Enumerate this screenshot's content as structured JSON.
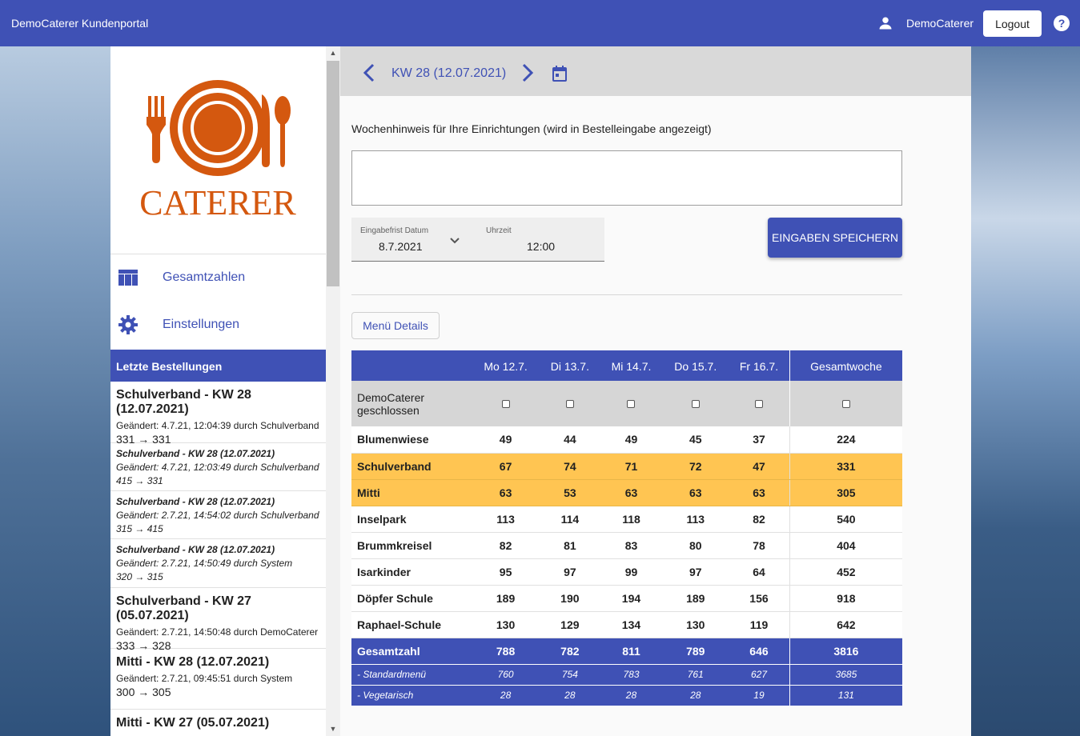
{
  "header": {
    "app_title": "DemoCaterer Kundenportal",
    "user_name": "DemoCaterer",
    "logout_label": "Logout",
    "help_glyph": "?"
  },
  "sidebar": {
    "logo_text": "CATERER",
    "nav": [
      {
        "label": "Gesamtzahlen",
        "icon": "table-icon"
      },
      {
        "label": "Einstellungen",
        "icon": "gear-icon"
      }
    ],
    "orders_title": "Letzte Bestellungen",
    "orders": [
      {
        "title": "Schulverband - KW 28 (12.07.2021)",
        "changed": "Geändert: 4.7.21, 12:04:39 durch Schulverband",
        "value": "331 → 331"
      },
      {
        "title": "Schulverband - KW 28 (12.07.2021)",
        "changed": "Geändert: 4.7.21, 12:03:49 durch Schulverband",
        "value": "415 → 331"
      },
      {
        "title": "Schulverband - KW 28 (12.07.2021)",
        "changed": "Geändert: 2.7.21, 14:54:02 durch Schulverband",
        "value": "315 → 415"
      },
      {
        "title": "Schulverband - KW 28 (12.07.2021)",
        "changed": "Geändert: 2.7.21, 14:50:49 durch System",
        "value": "320 → 315"
      },
      {
        "title": "Schulverband - KW 27 (05.07.2021)",
        "changed": "Geändert: 2.7.21, 14:50:48 durch DemoCaterer",
        "value": "333 → 328"
      },
      {
        "title": "Mitti - KW 28 (12.07.2021)",
        "changed": "Geändert: 2.7.21, 09:45:51 durch System",
        "value": "300 → 305"
      },
      {
        "title": "Mitti - KW 27 (05.07.2021)",
        "changed": "",
        "value": ""
      }
    ]
  },
  "main": {
    "week_label": "KW 28 (12.07.2021)",
    "hint_label": "Wochenhinweis für Ihre Einrichtungen (wird in Bestelleingabe angezeigt)",
    "hint_value": "",
    "deadline_date_label": "Eingabefrist Datum",
    "deadline_date_value": "8.7.2021",
    "deadline_time_label": "Uhrzeit",
    "deadline_time_value": "12:00",
    "save_label": "EINGABEN SPEICHERN",
    "menu_details_label": "Menü Details"
  },
  "table": {
    "columns": [
      "Mo 12.7.",
      "Di 13.7.",
      "Mi 14.7.",
      "Do 15.7.",
      "Fr 16.7.",
      "Gesamtwoche"
    ],
    "closed_label": "DemoCaterer geschlossen",
    "rows": [
      {
        "name": "Blumenwiese",
        "values": [
          "49",
          "44",
          "49",
          "45",
          "37",
          "224"
        ],
        "highlight": false
      },
      {
        "name": "Schulverband",
        "values": [
          "67",
          "74",
          "71",
          "72",
          "47",
          "331"
        ],
        "highlight": true
      },
      {
        "name": "Mitti",
        "values": [
          "63",
          "53",
          "63",
          "63",
          "63",
          "305"
        ],
        "highlight": true
      },
      {
        "name": "Inselpark",
        "values": [
          "113",
          "114",
          "118",
          "113",
          "82",
          "540"
        ],
        "highlight": false
      },
      {
        "name": "Brummkreisel",
        "values": [
          "82",
          "81",
          "83",
          "80",
          "78",
          "404"
        ],
        "highlight": false
      },
      {
        "name": "Isarkinder",
        "values": [
          "95",
          "97",
          "99",
          "97",
          "64",
          "452"
        ],
        "highlight": false
      },
      {
        "name": "Döpfer Schule",
        "values": [
          "189",
          "190",
          "194",
          "189",
          "156",
          "918"
        ],
        "highlight": false
      },
      {
        "name": "Raphael-Schule",
        "values": [
          "130",
          "129",
          "134",
          "130",
          "119",
          "642"
        ],
        "highlight": false
      }
    ],
    "total": {
      "name": "Gesamtzahl",
      "values": [
        "788",
        "782",
        "811",
        "789",
        "646",
        "3816"
      ]
    },
    "subtotals": [
      {
        "name": "- Standardmenü",
        "values": [
          "760",
          "754",
          "783",
          "761",
          "627",
          "3685"
        ]
      },
      {
        "name": "- Vegetarisch",
        "values": [
          "28",
          "28",
          "28",
          "28",
          "19",
          "131"
        ]
      }
    ]
  },
  "colors": {
    "primary": "#3f51b5",
    "highlight": "#ffc552",
    "logo": "#d4580f"
  }
}
